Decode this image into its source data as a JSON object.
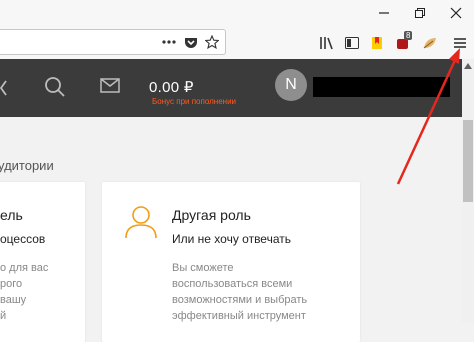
{
  "browser": {
    "extension_badge": "8"
  },
  "header": {
    "balance": "0.00 ₽",
    "bonus_text": "Бонус при пополнении",
    "avatar_letter": "N"
  },
  "content": {
    "audience_label_partial": "удитории",
    "left_card": {
      "title_partial": "ель",
      "subtitle_partial": "оцессов",
      "desc_lines": [
        "о для вас",
        "рого",
        "вашу",
        "й"
      ]
    },
    "right_card": {
      "title": "Другая роль",
      "subtitle": "Или не хочу отвечать",
      "desc_lines": [
        "Вы сможете",
        "воспользоваться всеми",
        "возможностями и выбрать",
        "эффективный инструмент"
      ]
    }
  },
  "colors": {
    "header_bg": "#3b3b3b",
    "accent_orange": "#f39c12",
    "bonus_orange": "#ff5a1f",
    "annotation_arrow": "#e5281e"
  }
}
